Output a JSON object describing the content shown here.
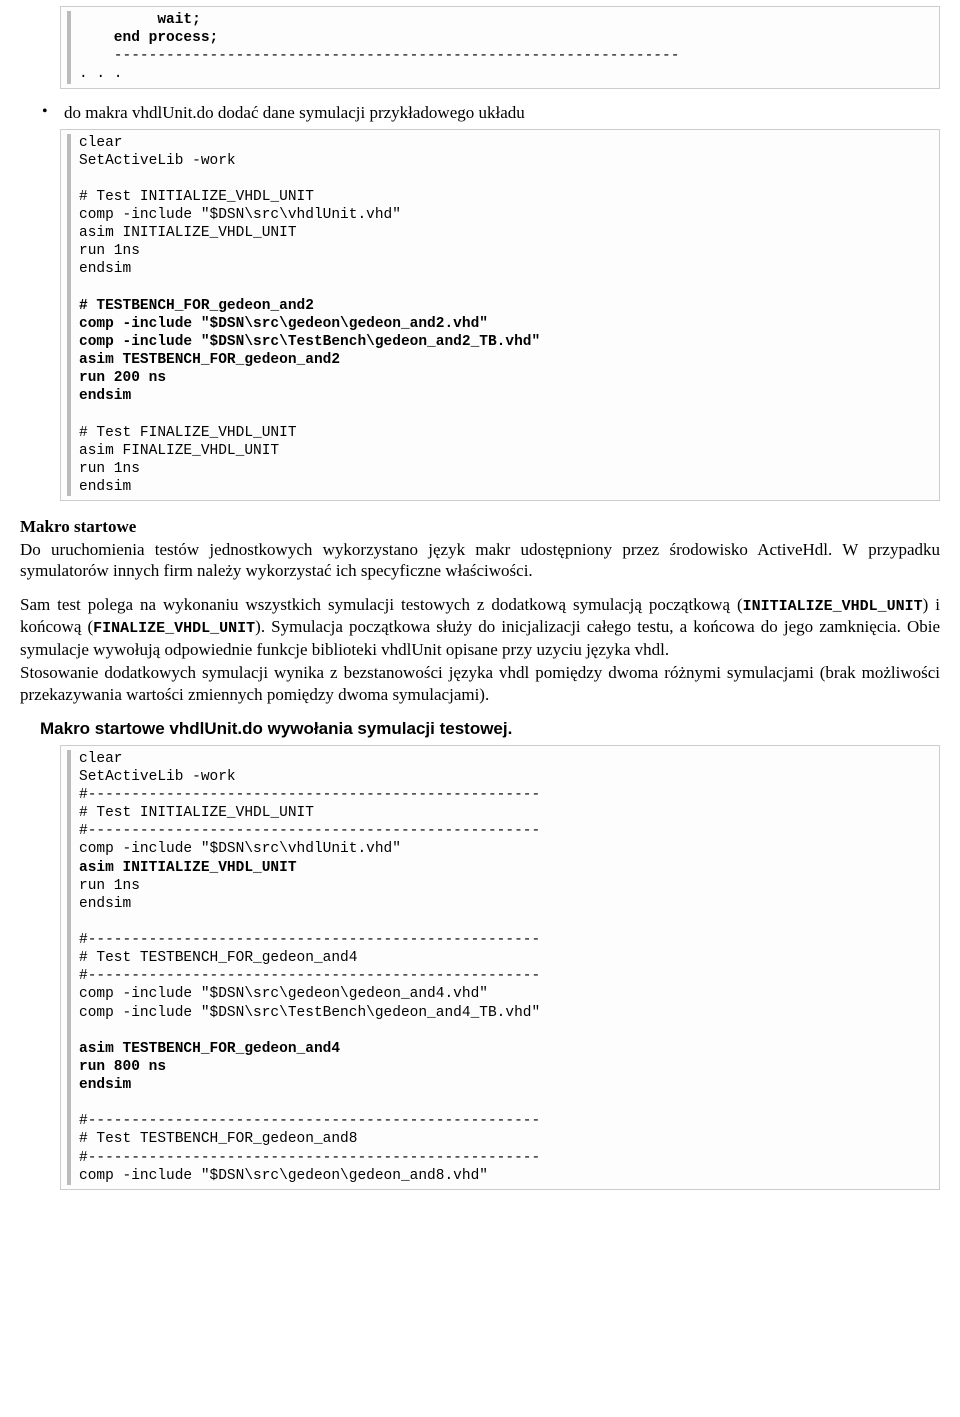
{
  "block1": {
    "l1": "         wait;",
    "l2": "    end process;",
    "l3": "    -----------------------------------------------------------------",
    "l4": ". . ."
  },
  "bullet1": "do makra vhdlUnit.do dodać dane symulacji przykładowego układu",
  "block2": {
    "l1": "clear",
    "l2": "SetActiveLib -work",
    "l3": "",
    "l4": "# Test INITIALIZE_VHDL_UNIT",
    "l5": "comp -include \"$DSN\\src\\vhdlUnit.vhd\"",
    "l6": "asim INITIALIZE_VHDL_UNIT",
    "l7": "run 1ns",
    "l8": "endsim",
    "l9": "",
    "l10": "# TESTBENCH_FOR_gedeon_and2",
    "l11": "comp -include \"$DSN\\src\\gedeon\\gedeon_and2.vhd\"",
    "l12": "comp -include \"$DSN\\src\\TestBench\\gedeon_and2_TB.vhd\"",
    "l13": "asim TESTBENCH_FOR_gedeon_and2",
    "l14": "run 200 ns",
    "l15": "endsim",
    "l16": "",
    "l17": "# Test FINALIZE_VHDL_UNIT",
    "l18": "asim FINALIZE_VHDL_UNIT",
    "l19": "run 1ns",
    "l20": "endsim"
  },
  "section_label": "Makro startowe",
  "para1": "Do uruchomienia testów jednostkowych wykorzystano język makr udostępniony przez środowisko ActiveHdl. W przypadku symulatorów innych firm należy wykorzystać ich specyficzne właściwości.",
  "para2_pre": "Sam test polega na wykonaniu wszystkich symulacji testowych z dodatkową symulacją początkową (",
  "para2_k1": "INITIALIZE_VHDL_UNIT",
  "para2_mid": ") i końcową (",
  "para2_k2": "FINALIZE_VHDL_UNIT",
  "para2_post": "). Symulacja początkowa służy do inicjalizacji całego testu, a końcowa do jego zamknięcia. Obie symulacje wywołują odpowiednie funkcje biblioteki vhdlUnit opisane przy uzyciu języka vhdl.",
  "para3": "Stosowanie dodatkowych symulacji wynika z bezstanowości języka vhdl pomiędzy dwoma różnymi symulacjami (brak możliwości przekazywania wartości zmiennych pomiędzy dwoma symulacjami).",
  "subheading": "Makro startowe vhdlUnit.do wywołania symulacji testowej.",
  "block3": {
    "l1": "clear",
    "l2": "SetActiveLib -work",
    "l3": "#----------------------------------------------------",
    "l4": "# Test INITIALIZE_VHDL_UNIT",
    "l5": "#----------------------------------------------------",
    "l6": "comp -include \"$DSN\\src\\vhdlUnit.vhd\"",
    "l7": "asim INITIALIZE_VHDL_UNIT",
    "l8": "run 1ns",
    "l9": "endsim",
    "l10": "",
    "l11": "#----------------------------------------------------",
    "l12": "# Test TESTBENCH_FOR_gedeon_and4",
    "l13": "#----------------------------------------------------",
    "l14": "comp -include \"$DSN\\src\\gedeon\\gedeon_and4.vhd\"",
    "l15": "comp -include \"$DSN\\src\\TestBench\\gedeon_and4_TB.vhd\"",
    "l16": "",
    "l17": "asim TESTBENCH_FOR_gedeon_and4",
    "l18": "run 800 ns",
    "l19": "endsim",
    "l20": "",
    "l21": "#----------------------------------------------------",
    "l22": "# Test TESTBENCH_FOR_gedeon_and8",
    "l23": "#----------------------------------------------------",
    "l24": "comp -include \"$DSN\\src\\gedeon\\gedeon_and8.vhd\""
  }
}
